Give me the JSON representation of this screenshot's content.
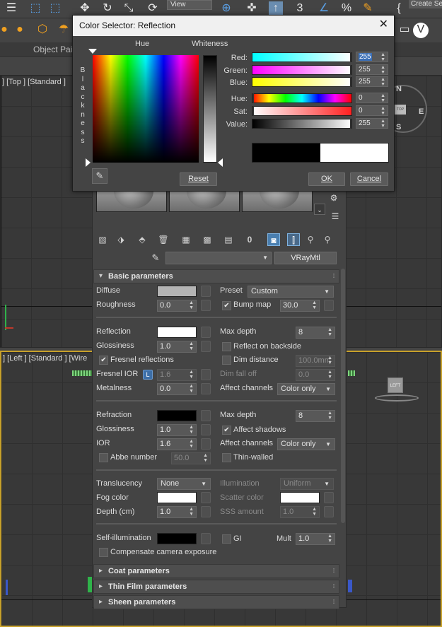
{
  "app": {
    "toolbar": {
      "view_dropdown": "View",
      "create_selection": "Create Sel"
    },
    "ribbon_tab": "Object Pai",
    "viewport_top_label": "[ + ] [Top ] [Standard ] [Wireframe ]",
    "viewport_top_label_visible": "] [Top ] [Standard ]",
    "viewport_left_label": "] [Left ] [Standard ] [Wire",
    "viewcube_top": {
      "n": "N",
      "e": "E",
      "s": "S",
      "box": "TOP"
    },
    "viewcube_left": {
      "box": "LEFT"
    }
  },
  "dialog": {
    "title": "Color Selector: Reflection",
    "hue_label": "Hue",
    "whiteness_label": "Whiteness",
    "blackness_label": "B\nl\na\nc\nk\nn\ne\ns\ns",
    "channels": [
      {
        "label": "Red:",
        "value": "255"
      },
      {
        "label": "Green:",
        "value": "255"
      },
      {
        "label": "Blue:",
        "value": "255"
      },
      {
        "label": "Hue:",
        "value": "0"
      },
      {
        "label": "Sat:",
        "value": "0"
      },
      {
        "label": "Value:",
        "value": "255"
      }
    ],
    "reset_button": "Reset",
    "ok_button": "OK",
    "cancel_button": "Cancel",
    "old_color": "#000000",
    "new_color": "#ffffff"
  },
  "material_editor": {
    "material_type": "VRayMtl",
    "material_name": "",
    "basic_rollout": "Basic parameters",
    "diffuse": {
      "label": "Diffuse",
      "color": "#b4b4b4"
    },
    "preset": {
      "label": "Preset",
      "value": "Custom"
    },
    "roughness": {
      "label": "Roughness",
      "value": "0.0"
    },
    "bump_map": {
      "label": "Bump map",
      "value": "30.0",
      "checked": true
    },
    "reflection": {
      "label": "Reflection",
      "color": "#ffffff"
    },
    "max_depth_refl": {
      "label": "Max depth",
      "value": "8"
    },
    "glossiness_refl": {
      "label": "Glossiness",
      "value": "1.0"
    },
    "reflect_backside": {
      "label": "Reflect on backside",
      "checked": false
    },
    "fresnel": {
      "label": "Fresnel reflections",
      "checked": true
    },
    "dim_distance": {
      "label": "Dim distance",
      "value": "100.0mm",
      "checked": false
    },
    "fresnel_ior": {
      "label": "Fresnel IOR",
      "lock": "L",
      "value": "1.6"
    },
    "dim_falloff": {
      "label": "Dim fall off",
      "value": "0.0"
    },
    "metalness": {
      "label": "Metalness",
      "value": "0.0"
    },
    "affect_channels_refl": {
      "label": "Affect channels",
      "value": "Color only"
    },
    "refraction": {
      "label": "Refraction",
      "color": "#000000"
    },
    "max_depth_refr": {
      "label": "Max depth",
      "value": "8"
    },
    "glossiness_refr": {
      "label": "Glossiness",
      "value": "1.0"
    },
    "affect_shadows": {
      "label": "Affect shadows",
      "checked": true
    },
    "ior": {
      "label": "IOR",
      "value": "1.6"
    },
    "affect_channels_refr": {
      "label": "Affect channels",
      "value": "Color only"
    },
    "abbe": {
      "label": "Abbe number",
      "value": "50.0",
      "checked": false
    },
    "thin_walled": {
      "label": "Thin-walled",
      "checked": false
    },
    "translucency": {
      "label": "Translucency",
      "value": "None"
    },
    "illumination": {
      "label": "Illumination",
      "value": "Uniform"
    },
    "fog_color": {
      "label": "Fog color",
      "color": "#ffffff"
    },
    "scatter_color": {
      "label": "Scatter color",
      "color": "#ffffff"
    },
    "depth": {
      "label": "Depth (cm)",
      "value": "1.0"
    },
    "sss_amount": {
      "label": "SSS amount",
      "value": "1.0"
    },
    "self_illum": {
      "label": "Self-illumination",
      "color": "#000000"
    },
    "gi": {
      "label": "GI",
      "checked": false
    },
    "mult": {
      "label": "Mult",
      "value": "1.0"
    },
    "compensate": {
      "label": "Compensate camera exposure",
      "checked": false
    },
    "coat_rollout": "Coat parameters",
    "thin_film_rollout": "Thin Film parameters",
    "sheen_rollout": "Sheen parameters"
  }
}
